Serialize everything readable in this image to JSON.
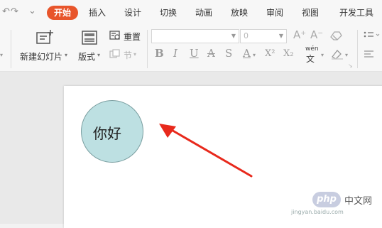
{
  "menubar": {
    "quick_access": [
      "↶",
      "↷",
      "⌄"
    ],
    "tabs": [
      {
        "label": "开始",
        "active": true
      },
      {
        "label": "插入"
      },
      {
        "label": "设计"
      },
      {
        "label": "切换"
      },
      {
        "label": "动画"
      },
      {
        "label": "放映"
      },
      {
        "label": "审阅"
      },
      {
        "label": "视图"
      },
      {
        "label": "开发工具"
      }
    ]
  },
  "ribbon": {
    "new_slide_label": "新建幻灯片",
    "layout_label": "版式",
    "reset_label": "重置",
    "section_label": "节",
    "font_size_value": "0",
    "format_buttons": [
      "B",
      "I",
      "U",
      "A",
      "S",
      "A",
      "X²",
      "X₂",
      "wén",
      "◇"
    ],
    "accent_color": "#e8552b"
  },
  "slide": {
    "shape_text": "你好",
    "shape_fill": "#bde0e2",
    "arrow_color": "#e8291c"
  },
  "watermark": {
    "badge": "php",
    "text": "中文网",
    "url": "jingyan.baidu.com"
  }
}
